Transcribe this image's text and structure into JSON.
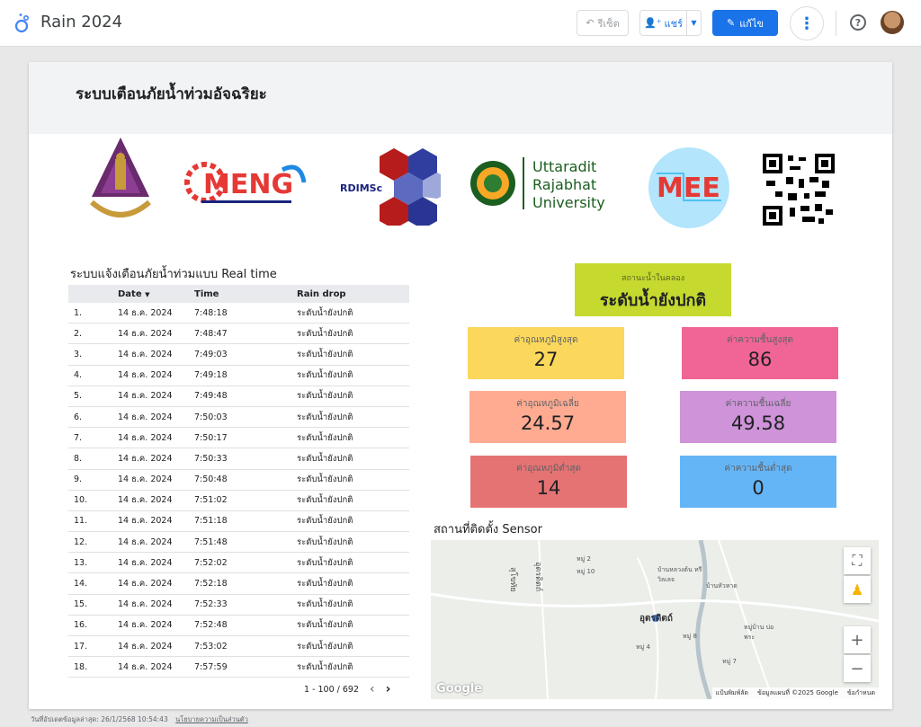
{
  "app": {
    "title": "Rain 2024",
    "reset_label": "รีเซ็ต",
    "share_label": "แชร์",
    "edit_label": "แก้ไข"
  },
  "report": {
    "title": "ระบบเตือนภัยน้ำท่วมอัจฉริยะ"
  },
  "logos": {
    "eng_text": "MENG",
    "rdimsc_text": "RDIMSc",
    "uru_line1": "Uttaradit",
    "uru_line2": "Rajabhat",
    "uru_line3": "University",
    "mee_text": "MEE"
  },
  "table": {
    "title": "ระบบแจ้งเตือนภัยน้ำท่วมแบบ Real time",
    "headers": {
      "date": "Date",
      "time": "Time",
      "rain": "Rain drop"
    },
    "rows": [
      {
        "n": "1.",
        "date": "14 ธ.ค. 2024",
        "time": "7:48:18",
        "rain": "ระดับน้ำยังปกติ"
      },
      {
        "n": "2.",
        "date": "14 ธ.ค. 2024",
        "time": "7:48:47",
        "rain": "ระดับน้ำยังปกติ"
      },
      {
        "n": "3.",
        "date": "14 ธ.ค. 2024",
        "time": "7:49:03",
        "rain": "ระดับน้ำยังปกติ"
      },
      {
        "n": "4.",
        "date": "14 ธ.ค. 2024",
        "time": "7:49:18",
        "rain": "ระดับน้ำยังปกติ"
      },
      {
        "n": "5.",
        "date": "14 ธ.ค. 2024",
        "time": "7:49:48",
        "rain": "ระดับน้ำยังปกติ"
      },
      {
        "n": "6.",
        "date": "14 ธ.ค. 2024",
        "time": "7:50:03",
        "rain": "ระดับน้ำยังปกติ"
      },
      {
        "n": "7.",
        "date": "14 ธ.ค. 2024",
        "time": "7:50:17",
        "rain": "ระดับน้ำยังปกติ"
      },
      {
        "n": "8.",
        "date": "14 ธ.ค. 2024",
        "time": "7:50:33",
        "rain": "ระดับน้ำยังปกติ"
      },
      {
        "n": "9.",
        "date": "14 ธ.ค. 2024",
        "time": "7:50:48",
        "rain": "ระดับน้ำยังปกติ"
      },
      {
        "n": "10.",
        "date": "14 ธ.ค. 2024",
        "time": "7:51:02",
        "rain": "ระดับน้ำยังปกติ"
      },
      {
        "n": "11.",
        "date": "14 ธ.ค. 2024",
        "time": "7:51:18",
        "rain": "ระดับน้ำยังปกติ"
      },
      {
        "n": "12.",
        "date": "14 ธ.ค. 2024",
        "time": "7:51:48",
        "rain": "ระดับน้ำยังปกติ"
      },
      {
        "n": "13.",
        "date": "14 ธ.ค. 2024",
        "time": "7:52:02",
        "rain": "ระดับน้ำยังปกติ"
      },
      {
        "n": "14.",
        "date": "14 ธ.ค. 2024",
        "time": "7:52:18",
        "rain": "ระดับน้ำยังปกติ"
      },
      {
        "n": "15.",
        "date": "14 ธ.ค. 2024",
        "time": "7:52:33",
        "rain": "ระดับน้ำยังปกติ"
      },
      {
        "n": "16.",
        "date": "14 ธ.ค. 2024",
        "time": "7:52:48",
        "rain": "ระดับน้ำยังปกติ"
      },
      {
        "n": "17.",
        "date": "14 ธ.ค. 2024",
        "time": "7:53:02",
        "rain": "ระดับน้ำยังปกติ"
      },
      {
        "n": "18.",
        "date": "14 ธ.ค. 2024",
        "time": "7:57:59",
        "rain": "ระดับน้ำยังปกติ"
      }
    ],
    "pager": "1 - 100 / 692"
  },
  "status": {
    "label": "สถานะน้ำในคลอง",
    "value": "ระดับน้ำยังปกติ",
    "color": "#c5d92e"
  },
  "cards": [
    {
      "label": "ค่าอุณหภูมิสูงสุด",
      "value": "27",
      "color": "#fbd75b"
    },
    {
      "label": "ค่าความชื้นสูงสุด",
      "value": "86",
      "color": "#f06595"
    },
    {
      "label": "ค่าอุณหภูมิเฉลี่ย",
      "value": "24.57",
      "color": "#ffab91"
    },
    {
      "label": "ค่าความชื้นเฉลี่ย",
      "value": "49.58",
      "color": "#ce93d8"
    },
    {
      "label": "ค่าอุณหภูมิต่ำสุด",
      "value": "14",
      "color": "#e57373"
    },
    {
      "label": "ค่าความชื้นต่ำสุด",
      "value": "0",
      "color": "#64b5f6"
    }
  ],
  "map": {
    "title": "สถานที่ติดตั้ง Sensor",
    "labels": [
      "หมู่ 2",
      "หมู่ 10",
      "บ้านหลวงต้น ทรี วิลเลจ",
      "บ้านหัวหาด",
      "อุตรดิตถ์",
      "สุโขทัย",
      "อุตรดิตถ์",
      "หมู่ 8",
      "หมู่ 4",
      "หมู่บ้าน บ่อพระ",
      "หมู่ 7"
    ],
    "footer": [
      "แป้นพิมพ์ลัด",
      "ข้อมูลแผนที่ ©2025 Google",
      "ข้อกำหนด"
    ],
    "google": "Google"
  },
  "footer": {
    "updated": "วันที่อัปเดตข้อมูลล่าสุด: 26/1/2568 10:54:43",
    "privacy": "นโยบายความเป็นส่วนตัว"
  }
}
